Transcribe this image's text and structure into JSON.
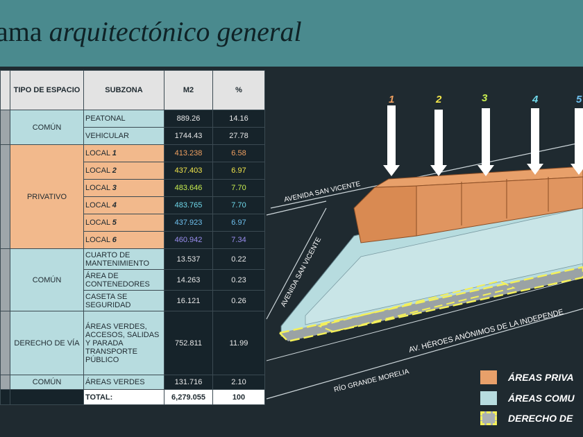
{
  "title": {
    "prefix": "ama",
    "italic": "arquitectónico general"
  },
  "table": {
    "headers": [
      "TIPO DE ESPACIO",
      "SUBZONA",
      "M2",
      "%"
    ],
    "rows": [
      {
        "tipo": "COMÚN",
        "sub": "PEATONAL",
        "m2": "889.26",
        "pct": "14.16"
      },
      {
        "sub": "VEHICULAR",
        "m2": "1744.43",
        "pct": "27.78"
      },
      {
        "tipo": "PRIVATIVO",
        "sub": "LOCAL",
        "n": "1",
        "m2": "413.238",
        "pct": "6.58",
        "color": "#f0a060"
      },
      {
        "sub": "LOCAL",
        "n": "2",
        "m2": "437.403",
        "pct": "6.97",
        "color": "#f2e64a"
      },
      {
        "sub": "LOCAL",
        "n": "3",
        "m2": "483.646",
        "pct": "7.70",
        "color": "#c8ee50"
      },
      {
        "sub": "LOCAL",
        "n": "4",
        "m2": "483.765",
        "pct": "7.70",
        "color": "#6fd8ea"
      },
      {
        "sub": "LOCAL",
        "n": "5",
        "m2": "437.923",
        "pct": "6.97",
        "color": "#6fc0ee"
      },
      {
        "sub": "LOCAL",
        "n": "6",
        "m2": "460.942",
        "pct": "7.34",
        "color": "#9a8ef0"
      },
      {
        "tipo": "COMÚN",
        "sub": "CUARTO DE MANTENIMIENTO",
        "m2": "13.537",
        "pct": "0.22"
      },
      {
        "sub": "ÁREA DE CONTENEDORES",
        "m2": "14.263",
        "pct": "0.23"
      },
      {
        "sub": "CASETA SE SEGURIDAD",
        "m2": "16.121",
        "pct": "0.26"
      },
      {
        "tipo": "DERECHO DE VÍA",
        "sub": "ÁREAS VERDES, ACCESOS, SALIDAS Y PARADA TRANSPORTE PÚBLICO",
        "m2": "752.811",
        "pct": "11.99"
      },
      {
        "tipo": "COMÚN",
        "sub": "ÁREAS VERDES",
        "m2": "131.716",
        "pct": "2.10"
      }
    ],
    "total": {
      "label": "TOTAL:",
      "m2": "6,279.055",
      "pct": "100"
    }
  },
  "plan": {
    "arrows": [
      {
        "n": "1",
        "color": "#f0a060"
      },
      {
        "n": "2",
        "color": "#f2e64a"
      },
      {
        "n": "3",
        "color": "#c8ee50"
      },
      {
        "n": "4",
        "color": "#6fd8ea"
      },
      {
        "n": "5",
        "color": "#6fc0ee"
      }
    ],
    "street1": "AVENIDA SAN VICENTE",
    "street2": "AVENIDA SAN VICENTE",
    "street3": "AV. HÉROES ANÓNIMOS DE LA INDEPENDE",
    "street4": "RÍO GRANDE MORELIA"
  },
  "legend": [
    {
      "label": "ÁREAS PRIVA",
      "color": "#e8a06a"
    },
    {
      "label": "ÁREAS COMU",
      "color": "#b7dcdf"
    },
    {
      "label": "DERECHO DE",
      "color": "#aab0b3"
    }
  ]
}
